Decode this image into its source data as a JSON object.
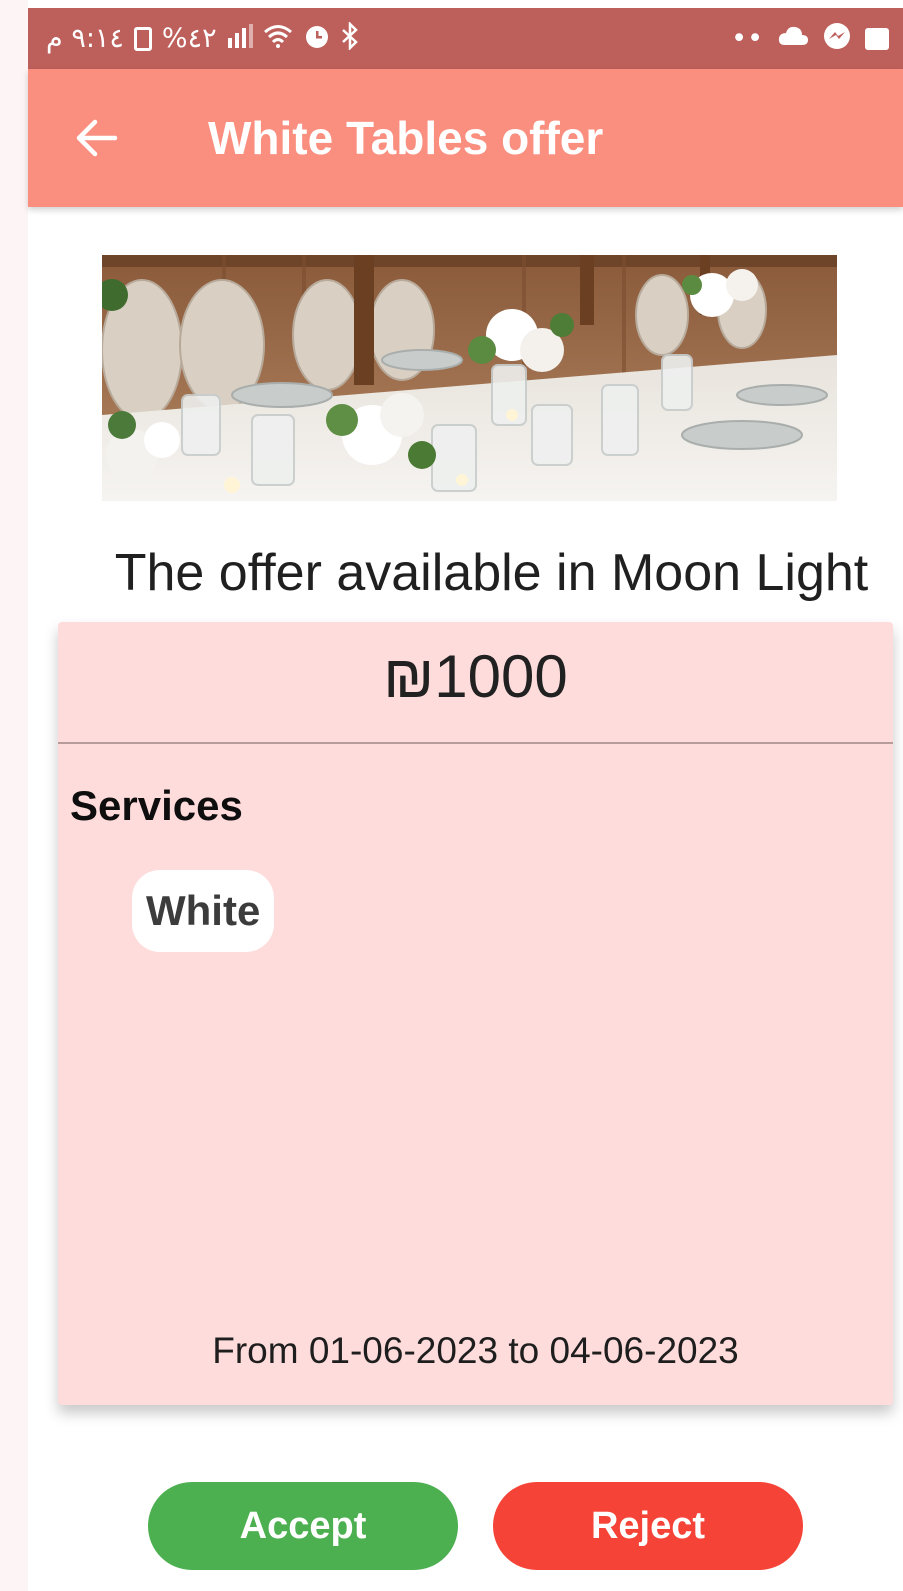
{
  "status_bar": {
    "time": "٩:١٤ م",
    "battery": "%٤٢",
    "right_indicator": "••"
  },
  "app_bar": {
    "title": "White Tables offer",
    "back_icon": "arrow-back-icon"
  },
  "offer": {
    "location_text": "The offer available in Moon Light",
    "price": "₪1000",
    "services_label": "Services",
    "services": [
      "White"
    ],
    "date_range": "From 01-06-2023 to 04-06-2023"
  },
  "actions": {
    "accept_label": "Accept",
    "reject_label": "Reject"
  },
  "colors": {
    "status_bar": "#bd5f5b",
    "app_bar": "#fa8e7f",
    "card": "#ffdcdc",
    "accept": "#4cb051",
    "reject": "#f54337"
  }
}
